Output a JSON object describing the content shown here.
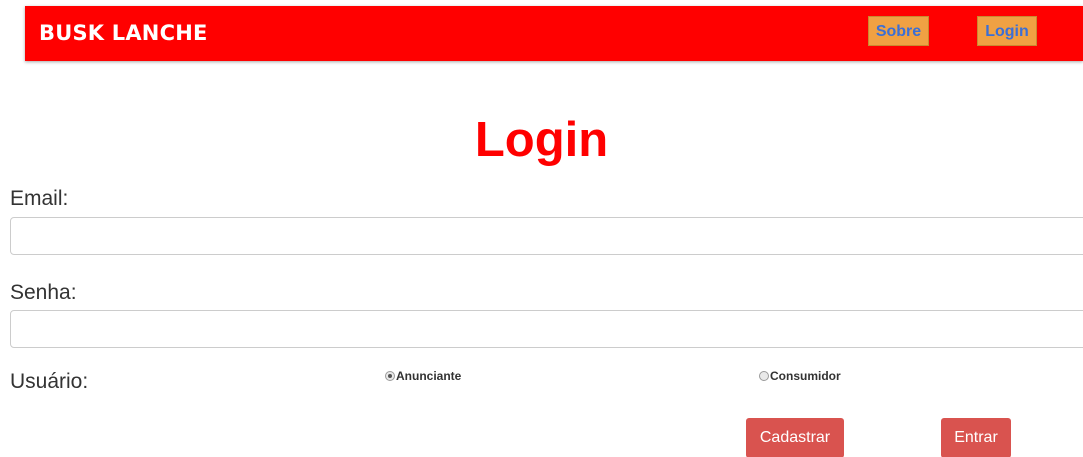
{
  "navbar": {
    "brand": "BUSK LANCHE",
    "links": {
      "sobre": "Sobre",
      "login": "Login"
    }
  },
  "main": {
    "title": "Login",
    "email_label": "Email:",
    "email_value": "",
    "senha_label": "Senha:",
    "senha_value": "",
    "usuario_label": "Usuário:",
    "usuario_options": [
      {
        "label": "Anunciante",
        "selected": true
      },
      {
        "label": "Consumidor",
        "selected": false
      }
    ],
    "buttons": {
      "cadastrar": "Cadastrar",
      "entrar": "Entrar"
    }
  },
  "colors": {
    "navbar_bg": "#ff0000",
    "nav_button_bg": "#f0a143",
    "nav_button_text": "#3b6fd6",
    "title": "#ff0000",
    "action_button_bg": "#d9534f"
  }
}
